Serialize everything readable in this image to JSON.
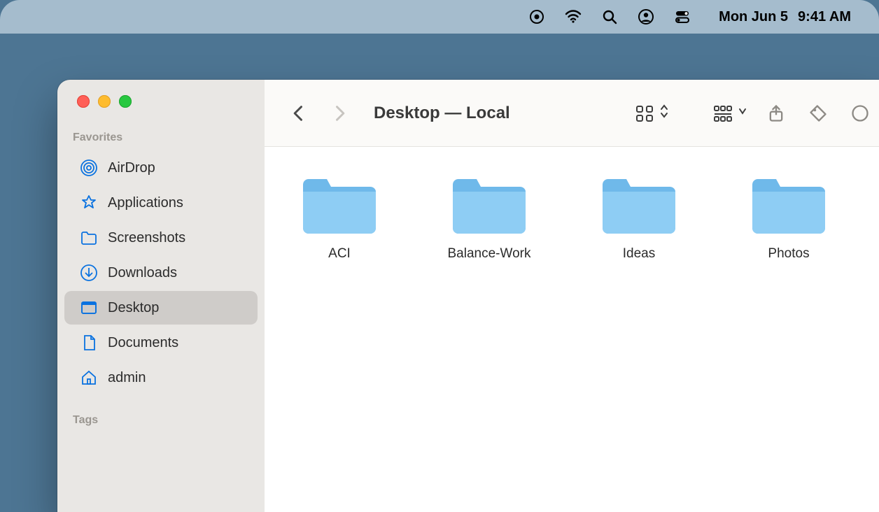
{
  "menubar": {
    "date": "Mon Jun 5",
    "time": "9:41 AM"
  },
  "window": {
    "title": "Desktop — Local"
  },
  "sidebar": {
    "sections": {
      "favorites_label": "Favorites",
      "tags_label": "Tags"
    },
    "items": [
      {
        "icon": "airdrop",
        "label": "AirDrop",
        "selected": false
      },
      {
        "icon": "applications",
        "label": "Applications",
        "selected": false
      },
      {
        "icon": "folder",
        "label": "Screenshots",
        "selected": false
      },
      {
        "icon": "downloads",
        "label": "Downloads",
        "selected": false
      },
      {
        "icon": "desktop",
        "label": "Desktop",
        "selected": true
      },
      {
        "icon": "documents",
        "label": "Documents",
        "selected": false
      },
      {
        "icon": "home",
        "label": "admin",
        "selected": false
      }
    ]
  },
  "folders": [
    {
      "name": "ACI"
    },
    {
      "name": "Balance-Work"
    },
    {
      "name": "Ideas"
    },
    {
      "name": "Photos"
    }
  ]
}
